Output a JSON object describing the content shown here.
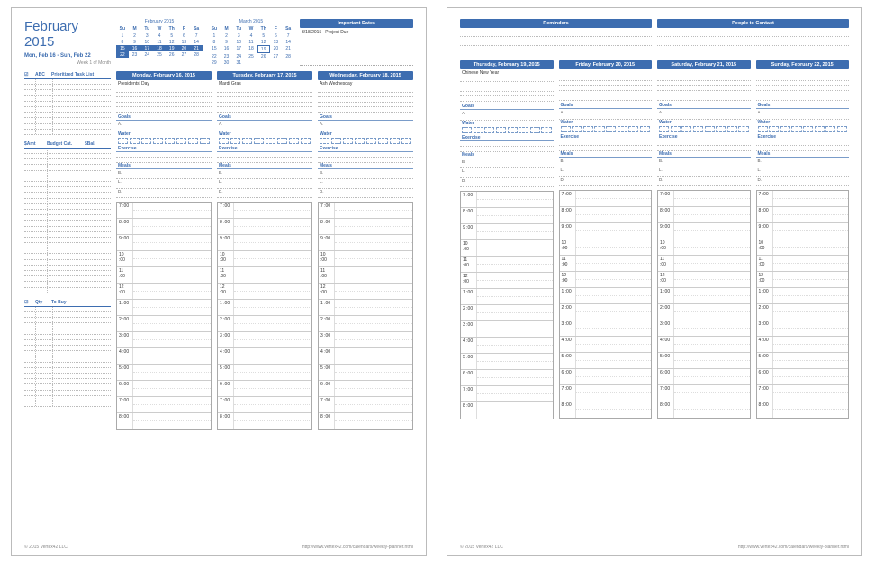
{
  "title": "February 2015",
  "week_range": "Mon, Feb 16  -  Sun, Feb 22",
  "week_label": "Week 1 of Month",
  "mini_cals": [
    {
      "title": "February 2015",
      "dhdr": [
        "Su",
        "M",
        "Tu",
        "W",
        "Th",
        "F",
        "Sa"
      ],
      "rows": [
        [
          "1",
          "2",
          "3",
          "4",
          "5",
          "6",
          "7"
        ],
        [
          "8",
          "9",
          "10",
          "11",
          "12",
          "13",
          "14"
        ],
        [
          "15",
          "16",
          "17",
          "18",
          "19",
          "20",
          "21"
        ],
        [
          "22",
          "23",
          "24",
          "25",
          "26",
          "27",
          "28"
        ],
        [
          "",
          "",
          "",
          "",
          "",
          "",
          ""
        ]
      ],
      "highlight_row": 2,
      "extra_highlight": [
        3,
        0
      ]
    },
    {
      "title": "March 2015",
      "dhdr": [
        "Su",
        "M",
        "Tu",
        "W",
        "Th",
        "F",
        "Sa"
      ],
      "rows": [
        [
          "1",
          "2",
          "3",
          "4",
          "5",
          "6",
          "7"
        ],
        [
          "8",
          "9",
          "10",
          "11",
          "12",
          "13",
          "14"
        ],
        [
          "15",
          "16",
          "17",
          "18",
          "19",
          "20",
          "21"
        ],
        [
          "22",
          "23",
          "24",
          "25",
          "26",
          "27",
          "28"
        ],
        [
          "29",
          "30",
          "31",
          "",
          "",
          "",
          ""
        ]
      ],
      "today": [
        2,
        4
      ]
    }
  ],
  "important_dates": {
    "header": "Important Dates",
    "items": [
      {
        "date": "3/18/2015",
        "text": "Project Due"
      }
    ]
  },
  "sidebar": {
    "task_list": {
      "c1": "☑",
      "c2": "ABC",
      "c3": "Prioritized Task List",
      "lines": 10
    },
    "budget": {
      "c1": "$Amt",
      "c2": "Budget Cat.",
      "c3": "$Bal.",
      "lines": 26
    },
    "to_buy": {
      "c1": "☑",
      "c2": "Qty",
      "c3": "To Buy",
      "lines": 18
    }
  },
  "sections": {
    "goals": "Goals",
    "goal_a": "A.",
    "water": "Water",
    "exercise": "Exercise",
    "meals": "Meals",
    "meal_b": "B.",
    "meal_l": "L.",
    "meal_d": "D."
  },
  "times": [
    "7 :00",
    "8 :00",
    "9 :00",
    "10 :00",
    "11 :00",
    "12 :00",
    "1 :00",
    "2 :00",
    "3 :00",
    "4 :00",
    "5 :00",
    "6 :00",
    "7 :00",
    "8 :00"
  ],
  "left_days": [
    {
      "header": "Monday, February 16, 2015",
      "event": "Presidents' Day"
    },
    {
      "header": "Tuesday, February 17, 2015",
      "event": "Mardi Gras"
    },
    {
      "header": "Wednesday, February 18, 2015",
      "event": "Ash Wednesday"
    }
  ],
  "right_top": {
    "reminders": "Reminders",
    "people": "People to Contact"
  },
  "right_days": [
    {
      "header": "Thursday, February 19, 2015",
      "event": "Chinese New Year"
    },
    {
      "header": "Friday, February 20, 2015",
      "event": ""
    },
    {
      "header": "Saturday, February 21, 2015",
      "event": ""
    },
    {
      "header": "Sunday, February 22, 2015",
      "event": ""
    }
  ],
  "footer": {
    "left": "© 2015 Vertex42 LLC",
    "right": "http://www.vertex42.com/calendars/weekly-planner.html"
  }
}
